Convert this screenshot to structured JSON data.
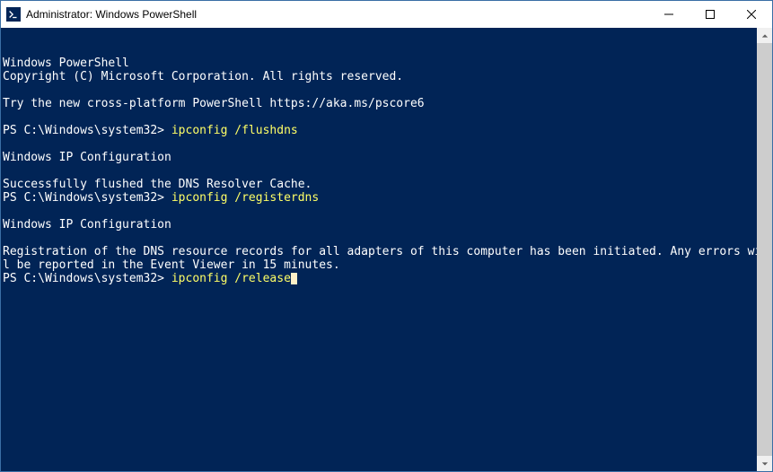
{
  "window": {
    "title": "Administrator: Windows PowerShell"
  },
  "terminal": {
    "banner": [
      "Windows PowerShell",
      "Copyright (C) Microsoft Corporation. All rights reserved.",
      "",
      "Try the new cross-platform PowerShell https://aka.ms/pscore6",
      ""
    ],
    "entries": [
      {
        "prompt": "PS C:\\Windows\\system32> ",
        "command": "ipconfig /flushdns",
        "output": [
          "",
          "Windows IP Configuration",
          "",
          "Successfully flushed the DNS Resolver Cache."
        ]
      },
      {
        "prompt": "PS C:\\Windows\\system32> ",
        "command": "ipconfig /registerdns",
        "output": [
          "",
          "Windows IP Configuration",
          "",
          "Registration of the DNS resource records for all adapters of this computer has been initiated. Any errors will be reported in the Event Viewer in 15 minutes."
        ]
      },
      {
        "prompt": "PS C:\\Windows\\system32> ",
        "command": "ipconfig /release",
        "output": []
      }
    ],
    "colors": {
      "background": "#012456",
      "text": "#ffffff",
      "command": "#ffff66",
      "cursor": "#fdf0c8"
    }
  }
}
